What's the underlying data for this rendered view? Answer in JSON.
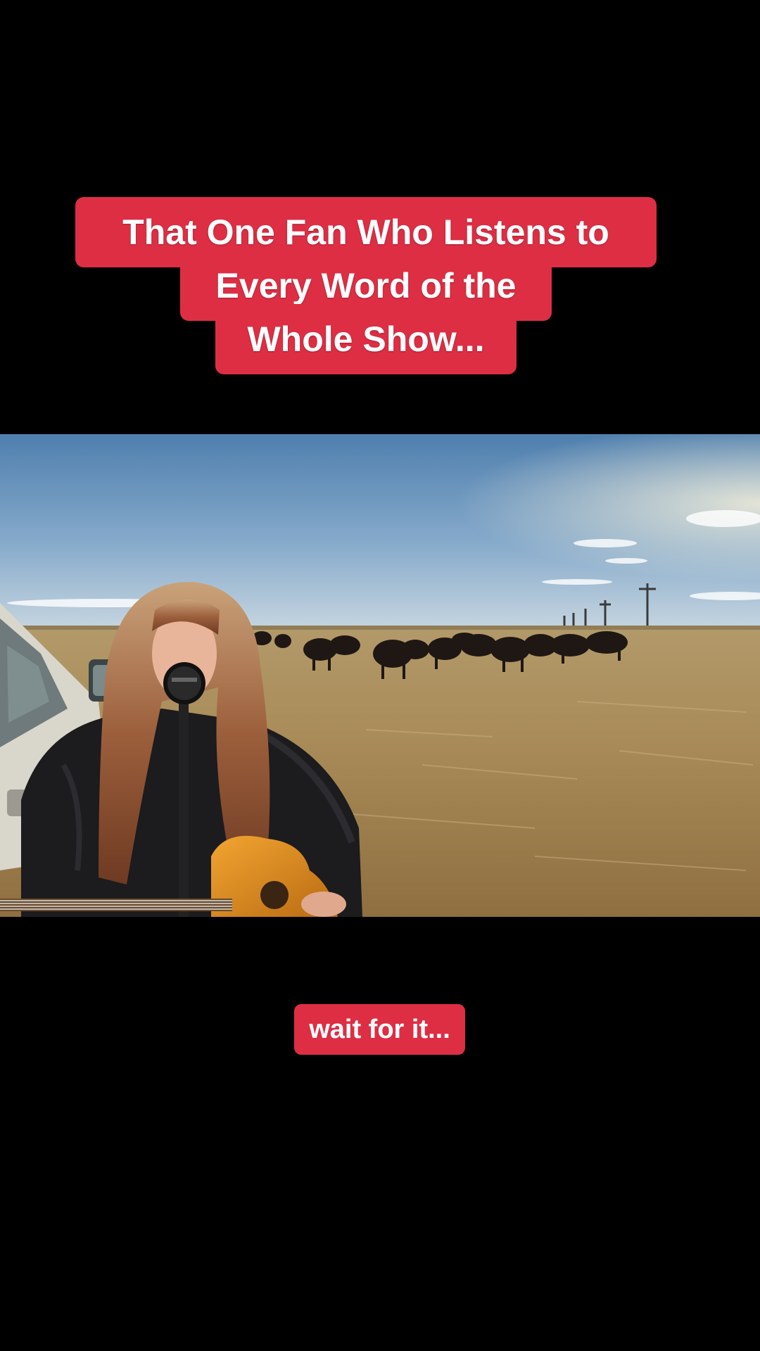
{
  "overlay": {
    "title_lines": [
      "That One Fan Who Listens to",
      "Every Word of the",
      "Whole Show..."
    ],
    "bottom_caption": "wait for it...",
    "caption_color": "#dd2e44"
  },
  "video": {
    "scene": "video-frame"
  }
}
